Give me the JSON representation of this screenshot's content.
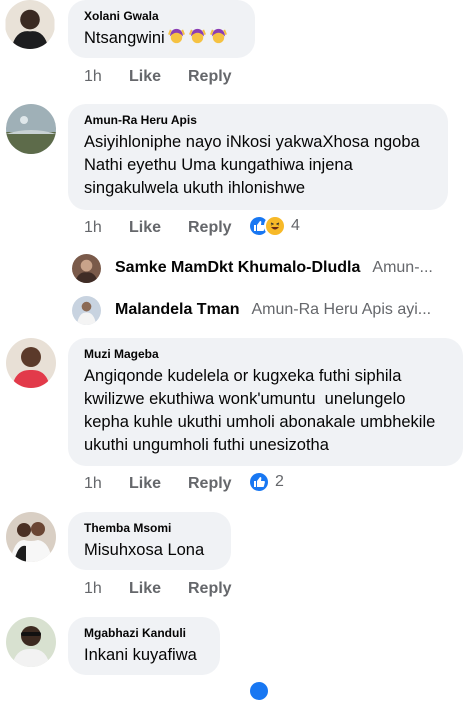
{
  "comments": [
    {
      "author": "Xolani Gwala",
      "text": "Ntsangwini",
      "emoji": "🙆",
      "time": "1h",
      "like": "Like",
      "reply": "Reply"
    },
    {
      "author": "Amun-Ra Heru Apis",
      "text_lines": [
        "Asiyihloniphe nayo iNkosi yakwaXhosa ngoba",
        "Nathi eyethu Uma kungathiwa injena",
        "singakulwela ukuth ihlonishwe"
      ],
      "time": "1h",
      "like": "Like",
      "reply": "Reply",
      "reaction_count": "4"
    },
    {
      "author": "Muzi Mageba",
      "text_lines": [
        "Angiqonde kudelela or kugxeka futhi siphila",
        "kwilizwe ekuthiwa wonk'umuntu  unelungelo",
        "kepha kuhle ukuthi umholi abonakale umbhekile",
        "ukuthi ungumholi futhi unesizotha"
      ],
      "time": "1h",
      "like": "Like",
      "reply": "Reply",
      "reaction_count": "2"
    },
    {
      "author": "Themba Msomi",
      "text": "Misuhxosa Lona",
      "time": "1h",
      "like": "Like",
      "reply": "Reply"
    },
    {
      "author": "Mgabhazi Kanduli",
      "text": "Inkani kuyafiwa"
    }
  ],
  "replies": [
    {
      "name": "Samke MamDkt Khumalo-Dludla",
      "preview": "Amun-..."
    },
    {
      "name": "Malandela Tman",
      "preview": "Amun-Ra Heru Apis ayi..."
    }
  ],
  "icons": [
    "like-reaction-icon",
    "haha-reaction-icon",
    "woman-gesturing-ok-emoji"
  ],
  "colors": {
    "bubble": "#f0f2f5",
    "meta": "#65676b",
    "like_blue": "#1877f2",
    "haha_yellow": "#f7b928"
  }
}
